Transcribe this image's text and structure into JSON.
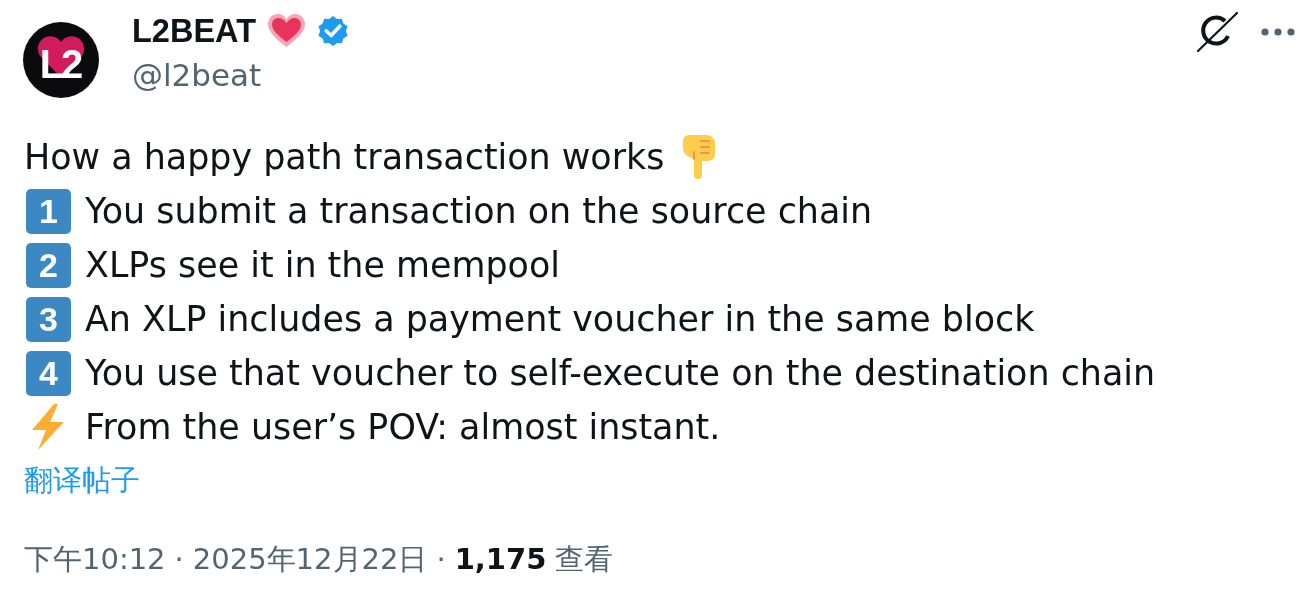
{
  "author": {
    "logo_text": "L2",
    "name": "L2BEAT",
    "verified": true,
    "handle": "@l2beat"
  },
  "lines": [
    {
      "kind": "heading",
      "text": "How a happy path transaction works"
    },
    {
      "kind": "step",
      "marker": "1",
      "text": "You submit a transaction on the source chain"
    },
    {
      "kind": "step",
      "marker": "2",
      "text": "XLPs see it in the mempool"
    },
    {
      "kind": "step",
      "marker": "3",
      "text": "An XLP includes a payment voucher in the same block"
    },
    {
      "kind": "step",
      "marker": "4",
      "text": "You use that voucher to self-execute on the destination chain"
    },
    {
      "kind": "bolt",
      "text": "From the user’s POV: almost instant."
    }
  ],
  "translate_link": "翻译帖子",
  "meta": [
    {
      "kind": "time",
      "text": "下午10:12"
    },
    {
      "kind": "separator",
      "text": "·"
    },
    {
      "kind": "date",
      "text": "2025年12月22日"
    },
    {
      "kind": "separator",
      "text": "·"
    },
    {
      "kind": "count",
      "text": "1,175"
    },
    {
      "kind": "label",
      "text": "查看"
    }
  ]
}
